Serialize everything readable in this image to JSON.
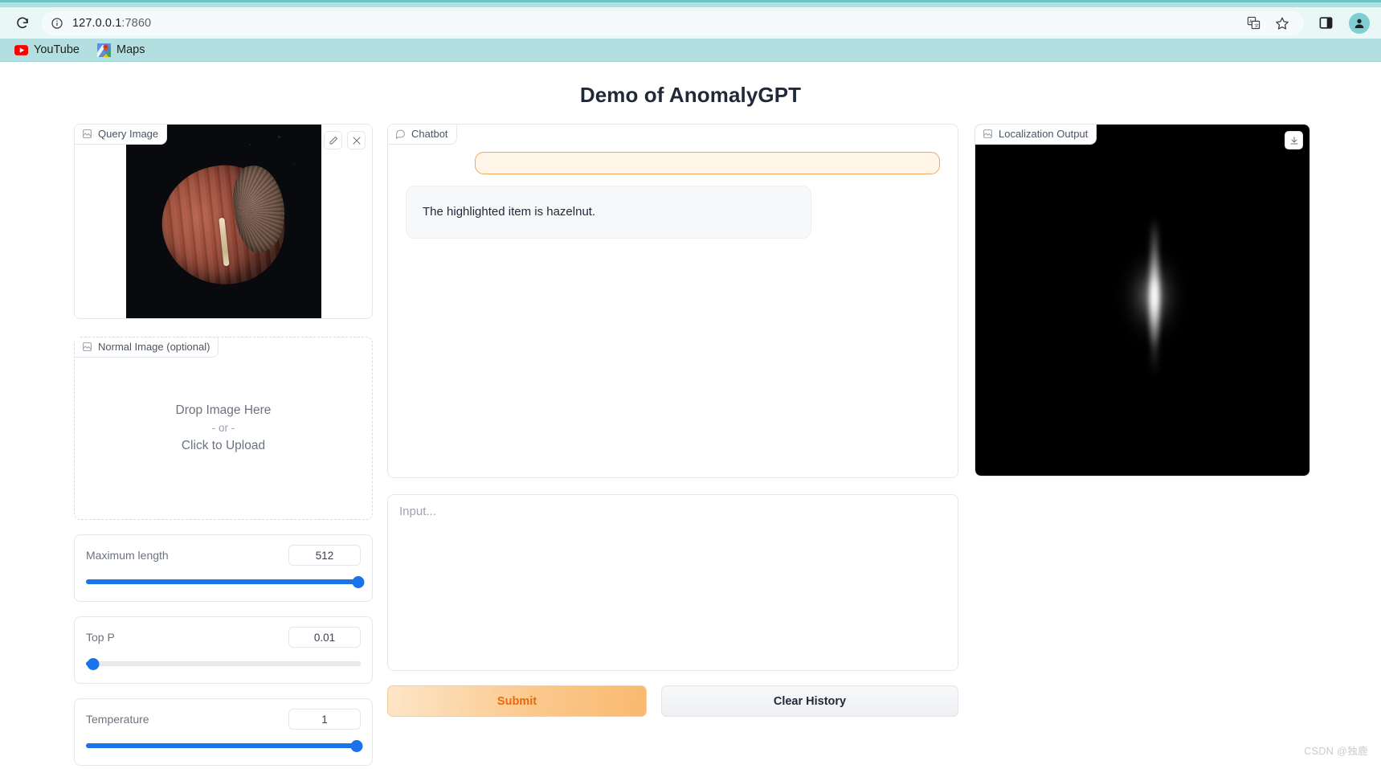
{
  "browser": {
    "reload_icon": "reload-icon",
    "url": "127.0.0.1",
    "url_port": ":7860",
    "site_info_icon": "site-info-icon",
    "translate_icon": "translate-icon",
    "bookmark_star_icon": "bookmark-star-icon",
    "side_panel_icon": "side-panel-icon",
    "profile_icon": "profile-avatar-icon",
    "bookmarks": [
      {
        "label": "YouTube",
        "icon": "youtube-icon"
      },
      {
        "label": "Maps",
        "icon": "google-maps-icon"
      }
    ]
  },
  "app": {
    "title": "Demo of AnomalyGPT"
  },
  "query_image": {
    "label": "Query Image",
    "label_icon": "image-icon",
    "edit_icon": "pencil-icon",
    "clear_icon": "close-icon",
    "alt": "hazelnut photo on black background"
  },
  "normal_image": {
    "label": "Normal Image (optional)",
    "label_icon": "image-icon",
    "drop_text": "Drop Image Here",
    "or_text": "- or -",
    "upload_text": "Click to Upload"
  },
  "sliders": [
    {
      "name": "maximum-length",
      "label": "Maximum length",
      "value": "512",
      "percent": 100
    },
    {
      "name": "top-p",
      "label": "Top P",
      "value": "0.01",
      "percent": 2
    },
    {
      "name": "temperature",
      "label": "Temperature",
      "value": "1",
      "percent": 98
    }
  ],
  "chatbot": {
    "label": "Chatbot",
    "label_icon": "chat-bubble-icon",
    "messages": [
      {
        "role": "user",
        "text": ""
      },
      {
        "role": "bot",
        "text": "The highlighted item is hazelnut."
      }
    ]
  },
  "input": {
    "placeholder": "Input...",
    "value": ""
  },
  "actions": {
    "submit_label": "Submit",
    "clear_label": "Clear History"
  },
  "localization": {
    "label": "Localization Output",
    "label_icon": "image-icon",
    "download_icon": "download-icon",
    "alt": "grayscale anomaly heatmap with bright vertical streak"
  },
  "watermark": {
    "text": "CSDN @独鹿"
  },
  "colors": {
    "accent_blue": "#1a73e8",
    "submit_orange": "#e8690f",
    "user_bubble_border": "#f0a860",
    "chrome_teal": "#b4dfe0",
    "toolbar_bg": "#e9f7f6"
  }
}
